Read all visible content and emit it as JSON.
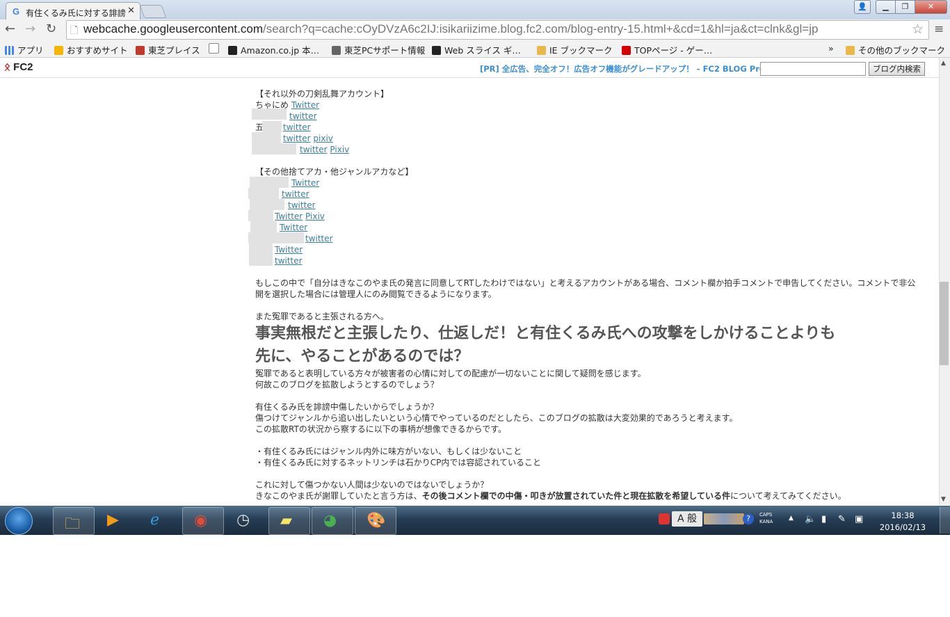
{
  "browser": {
    "tab_title": "有住くるみ氏に対する誹謗",
    "tab_favicon": "G",
    "url_host": "webcache.googleusercontent.com",
    "url_rest": "/search?q=cache:cOyDVzA6c2IJ:isikariizime.blog.fc2.com/blog-entry-15.html+&cd=1&hl=ja&ct=clnk&gl=jp"
  },
  "bookmarks": {
    "items": [
      {
        "label": "アプリ",
        "icon": "apps-icon",
        "color": "#4285f4"
      },
      {
        "label": "おすすめサイト",
        "icon": "bing-icon",
        "color": "#f4b400"
      },
      {
        "label": "東芝プレイス",
        "icon": "toshiba-place-icon",
        "color": "#c0392b"
      },
      {
        "label": "",
        "icon": "page-icon",
        "color": "#888888"
      },
      {
        "label": "Amazon.co.jp 本…",
        "icon": "amazon-icon",
        "color": "#222222"
      },
      {
        "label": "東芝PCサポート情報",
        "icon": "toshiba-support-icon",
        "color": "#555555"
      },
      {
        "label": "Web スライス ギ…",
        "icon": "web-slice-icon",
        "color": "#222222"
      },
      {
        "label": "IE ブックマーク",
        "icon": "folder-icon",
        "color": "#e8b84a"
      },
      {
        "label": "TOPページ - ゲー…",
        "icon": "yahoo-icon",
        "color": "#d50000"
      }
    ],
    "overflow": "»",
    "other_label": "その他のブックマーク"
  },
  "fc2": {
    "logo": "FC2",
    "pr_text": "[PR] 全広告、完全オフ！広告オフ機能がグレードアップ！ - FC2 BLOG Pro",
    "search_button": "ブログ内検索"
  },
  "content": {
    "section1_title": "【それ以外の刀剣乱舞アカウント】",
    "section1": [
      {
        "prefix": "ちゃにめ",
        "links": [
          "Twitter"
        ]
      },
      {
        "prefix": "",
        "links": [
          "twitter"
        ]
      },
      {
        "prefix": "五",
        "links": [
          "twitter"
        ]
      },
      {
        "prefix": "",
        "links": [
          "twitter",
          "pixiv"
        ]
      },
      {
        "prefix": "",
        "links": [
          "twitter",
          "Pixiv"
        ]
      }
    ],
    "section2_title": "【その他捨てアカ・他ジャンルアカなど】",
    "section2": [
      {
        "links": [
          "Twitter"
        ]
      },
      {
        "links": [
          "twitter"
        ]
      },
      {
        "links": [
          "twitter"
        ]
      },
      {
        "links": [
          "Twitter",
          "Pixiv"
        ]
      },
      {
        "links": [
          "Twitter"
        ]
      },
      {
        "links": [
          "twitter"
        ]
      },
      {
        "links": [
          "Twitter"
        ]
      },
      {
        "links": [
          "twitter"
        ]
      }
    ],
    "para1_line1": "もしこの中で「自分はきなこのやま氏の発言に同意してRTしたわけではない」と考えるアカウントがある場合、コメント欄か拍手コメントで申告してください。コメントで非公",
    "para1_line2": "開を選択した場合には管理人にのみ閲覧できるようになります。",
    "para2": "また冤罪であると主張される方へ。",
    "heading_line1": "事実無根だと主張したり、仕返しだ！と有住くるみ氏への攻撃をしかけることよりも",
    "heading_line2": "先に、やることがあるのでは？",
    "para3_line1": "冤罪であると表明している方々が被害者の心情に対しての配慮が一切ないことに関して疑問を感じます。",
    "para3_line2": "何故このブログを拡散しようとするのでしょう？",
    "para4_line1": "有住くるみ氏を誹謗中傷したいからでしょうか？",
    "para4_line2": "傷つけてジャンルから追い出したいという心情でやっているのだとしたら、このブログの拡散は大変効果的であろうと考えます。",
    "para4_line3": "この拡散RTの状況から察するに以下の事柄が想像できるからです。",
    "bullet1": "・有住くるみ氏にはジャンル内外に味方がいない、もしくは少ないこと",
    "bullet2": "・有住くるみ氏に対するネットリンチは石かりCP内では容認されていること",
    "para5_line1": "これに対して傷つかない人間は少ないのではないでしょうか？",
    "para5_line2_a": "きなこのやま氏が謝罪していたと言う方は、",
    "para5_line2_b": "その後コメント欄での中傷・叩きが放置されていた件と現在拡散を希望している件",
    "para5_line2_c": "について考えてみてください。"
  },
  "taskbar": {
    "apps": [
      "explorer-icon",
      "media-player-icon",
      "ie-icon",
      "chrome-icon",
      "clock-app-icon",
      "sticky-notes-icon",
      "picasa-icon",
      "paint-icon"
    ],
    "ime_mode": "A",
    "ime_type": "般",
    "caps": "CAPS",
    "kana": "KANA",
    "time": "18:38",
    "date": "2016/02/13"
  }
}
